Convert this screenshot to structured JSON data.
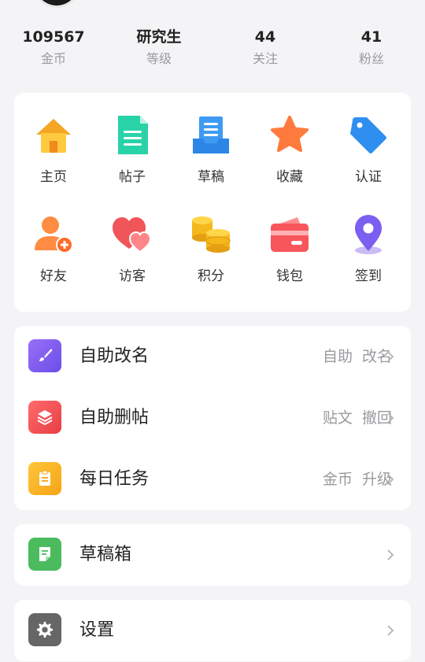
{
  "stats": [
    {
      "value": "109567",
      "label": "金币"
    },
    {
      "value": "研究生",
      "label": "等级"
    },
    {
      "value": "44",
      "label": "关注"
    },
    {
      "value": "41",
      "label": "粉丝"
    }
  ],
  "grid": [
    {
      "label": "主页",
      "icon": "home-icon"
    },
    {
      "label": "帖子",
      "icon": "document-icon"
    },
    {
      "label": "草稿",
      "icon": "draft-tray-icon"
    },
    {
      "label": "收藏",
      "icon": "star-icon"
    },
    {
      "label": "认证",
      "icon": "tag-icon"
    },
    {
      "label": "好友",
      "icon": "add-friend-icon"
    },
    {
      "label": "访客",
      "icon": "hearts-icon"
    },
    {
      "label": "积分",
      "icon": "coins-icon"
    },
    {
      "label": "钱包",
      "icon": "wallet-icon"
    },
    {
      "label": "签到",
      "icon": "location-pin-icon"
    }
  ],
  "menu": [
    {
      "title": "自助改名",
      "right": [
        "自助",
        "改名"
      ],
      "icon": "brush-icon",
      "color": "#7a5cf0"
    },
    {
      "title": "自助删帖",
      "right": [
        "贴文",
        "撤回"
      ],
      "icon": "layers-icon",
      "color": "#ee4b4b"
    },
    {
      "title": "每日任务",
      "right": [
        "金币",
        "升级"
      ],
      "icon": "clipboard-icon",
      "color": "#f7b21f"
    }
  ],
  "drafts": {
    "title": "草稿箱",
    "icon": "note-icon",
    "color": "#4cbb5e"
  },
  "settings": {
    "title": "设置",
    "icon": "gear-icon",
    "color": "#666666"
  }
}
